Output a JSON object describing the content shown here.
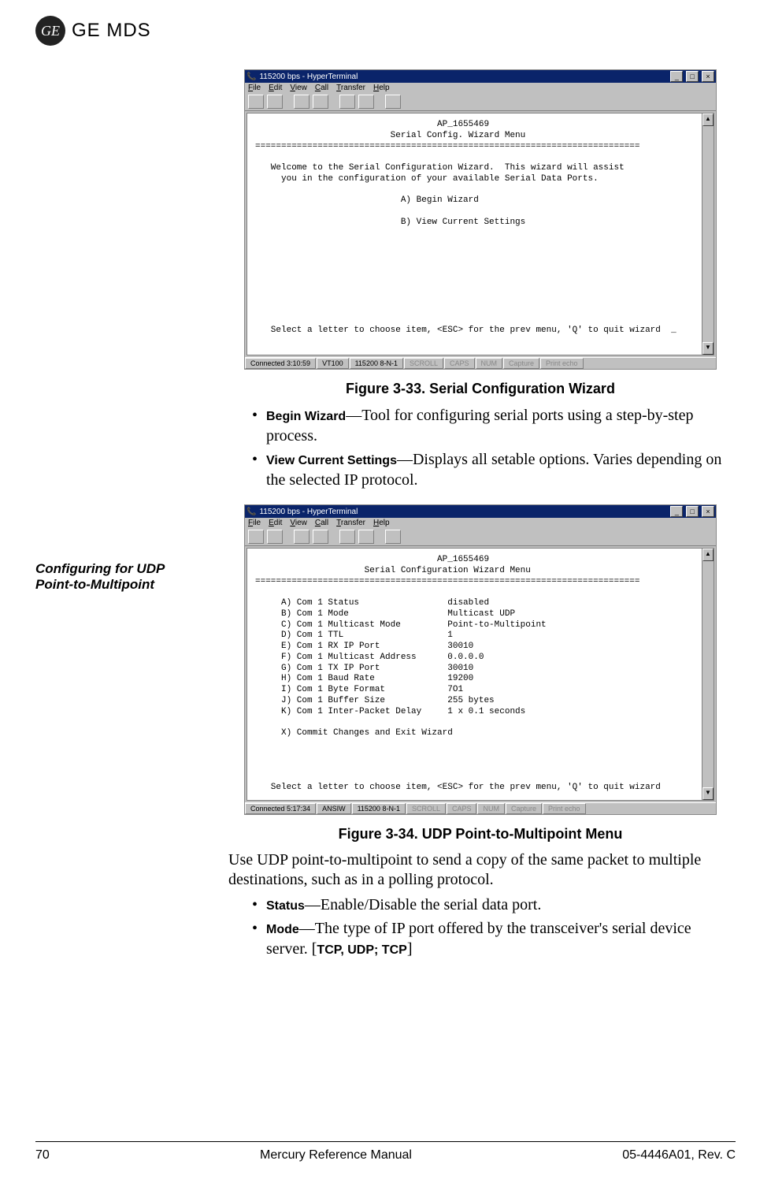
{
  "header": {
    "logo_text": "GE MDS",
    "ge_mono": "GE"
  },
  "figure1": {
    "caption": "Figure 3-33. Serial Configuration Wizard",
    "window_title": "115200 bps - HyperTerminal",
    "menus": [
      "File",
      "Edit",
      "View",
      "Call",
      "Transfer",
      "Help"
    ],
    "terminal_lines": "                                   AP_1655469\n                          Serial Config. Wizard Menu\n==========================================================================\n\n   Welcome to the Serial Configuration Wizard.  This wizard will assist\n     you in the configuration of your available Serial Data Ports.\n\n                            A) Begin Wizard\n\n                            B) View Current Settings\n\n\n\n\n\n\n\n\n\n   Select a letter to choose item, <ESC> for the prev menu, 'Q' to quit wizard  _",
    "status": {
      "connected": "Connected 3:10:59",
      "emul": "VT100",
      "port": "115200 8-N-1",
      "scroll": "SCROLL",
      "caps": "CAPS",
      "num": "NUM",
      "capture": "Capture",
      "print": "Print echo"
    }
  },
  "bullets1": {
    "b1_name": "Begin Wizard",
    "b1_text": "—Tool for configuring serial ports using a step-by-step process.",
    "b2_name": "View Current Settings",
    "b2_text": "—Displays all setable options. Varies depending on the selected IP protocol."
  },
  "sidebar": {
    "heading": "Configuring for UDP Point-to-Multipoint"
  },
  "figure2": {
    "caption": "Figure 3-34. UDP Point-to-Multipoint Menu",
    "window_title": "115200 bps - HyperTerminal",
    "menus": [
      "File",
      "Edit",
      "View",
      "Call",
      "Transfer",
      "Help"
    ],
    "terminal_lines": "                                   AP_1655469\n                     Serial Configuration Wizard Menu\n==========================================================================\n\n     A) Com 1 Status                 disabled\n     B) Com 1 Mode                   Multicast UDP\n     C) Com 1 Multicast Mode         Point-to-Multipoint\n     D) Com 1 TTL                    1\n     E) Com 1 RX IP Port             30010\n     F) Com 1 Multicast Address      0.0.0.0\n     G) Com 1 TX IP Port             30010\n     H) Com 1 Baud Rate              19200\n     I) Com 1 Byte Format            7O1\n     J) Com 1 Buffer Size            255 bytes\n     K) Com 1 Inter-Packet Delay     1 x 0.1 seconds\n\n     X) Commit Changes and Exit Wizard\n\n\n\n\n   Select a letter to choose item, <ESC> for the prev menu, 'Q' to quit wizard",
    "status": {
      "connected": "Connected 5:17:34",
      "emul": "ANSIW",
      "port": "115200 8-N-1",
      "scroll": "SCROLL",
      "caps": "CAPS",
      "num": "NUM",
      "capture": "Capture",
      "print": "Print echo"
    }
  },
  "paragraph2": "Use UDP point-to-multipoint to send a copy of the same packet to multiple destinations, such as in a polling protocol.",
  "bullets2": {
    "b1_name": "Status",
    "b1_text": "—Enable/Disable the serial data port.",
    "b2_name": "Mode",
    "b2_text": "—The type of IP port offered by the transceiver's serial device server. [",
    "b2_opts": "TCP, UDP; TCP",
    "b2_close": "]"
  },
  "footer": {
    "page": "70",
    "title": "Mercury Reference Manual",
    "doc": "05-4446A01, Rev. C"
  }
}
